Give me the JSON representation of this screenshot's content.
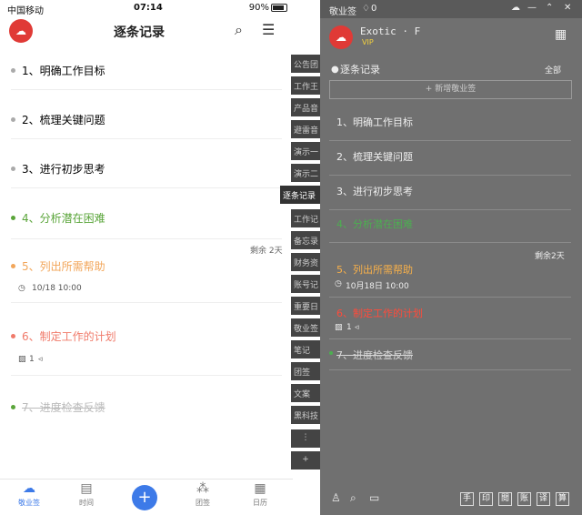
{
  "status": {
    "carrier": "中国移动",
    "time": "07:14",
    "battery": "90%"
  },
  "header": {
    "title": "逐条记录",
    "logo": "cloud-logo"
  },
  "notes": [
    {
      "text": "1、明确工作目标",
      "color": "#222222"
    },
    {
      "text": "2、梳理关键问题",
      "color": "#222222"
    },
    {
      "text": "3、进行初步思考",
      "color": "#222222"
    },
    {
      "text": "4、分析潜在困难",
      "color": "#5aa53a"
    },
    {
      "text": "5、列出所需帮助",
      "color": "#f2a65a",
      "remaining": "剩余 2天",
      "date": "10/18 10:00"
    },
    {
      "text": "6、制定工作的计划",
      "color": "#f07a6a",
      "attach": "1"
    },
    {
      "text": "7、进度检查反馈",
      "color": "#bbbbbb"
    }
  ],
  "tabs": [
    "公告团",
    "工作王",
    "产品音",
    "避雷音",
    "演示一",
    "演示二",
    "逐条记录",
    "工作记",
    "备忘录",
    "财务资",
    "账号记",
    "重要日",
    "敬业签",
    "笔记",
    "团签",
    "文案",
    "黑科技",
    "⋮",
    "+"
  ],
  "nav": [
    {
      "label": "敬业签",
      "icon": "cloud"
    },
    {
      "label": "时间",
      "icon": "calendar"
    },
    {
      "label": "团签",
      "icon": "group"
    },
    {
      "label": "日历",
      "icon": "calendar-16"
    }
  ],
  "desktop": {
    "app": "敬业签",
    "count": "0",
    "user": "Exotic · F",
    "vip": "VIP",
    "list_title": "逐条记录",
    "filter": "全部",
    "new_note": "+ 新增敬业签",
    "notes": [
      {
        "text": "1、明确工作目标",
        "color": "#ffffff"
      },
      {
        "text": "2、梳理关键问题",
        "color": "#ffffff"
      },
      {
        "text": "3、进行初步思考",
        "color": "#ffffff"
      },
      {
        "text": "4、分析潜在困难",
        "color": "#4caf50"
      },
      {
        "text": "5、列出所需帮助",
        "color": "#f7b04a",
        "remaining": "剩余2天",
        "date": "10月18日 10:00"
      },
      {
        "text": "6、制定工作的计划",
        "color": "#ff4b3b",
        "attach": "1"
      },
      {
        "text": "7、进度检查反馈",
        "color": "#d8d8d8"
      }
    ],
    "toolbar": [
      "手",
      "印",
      "閲",
      "账",
      "译",
      "算"
    ]
  }
}
